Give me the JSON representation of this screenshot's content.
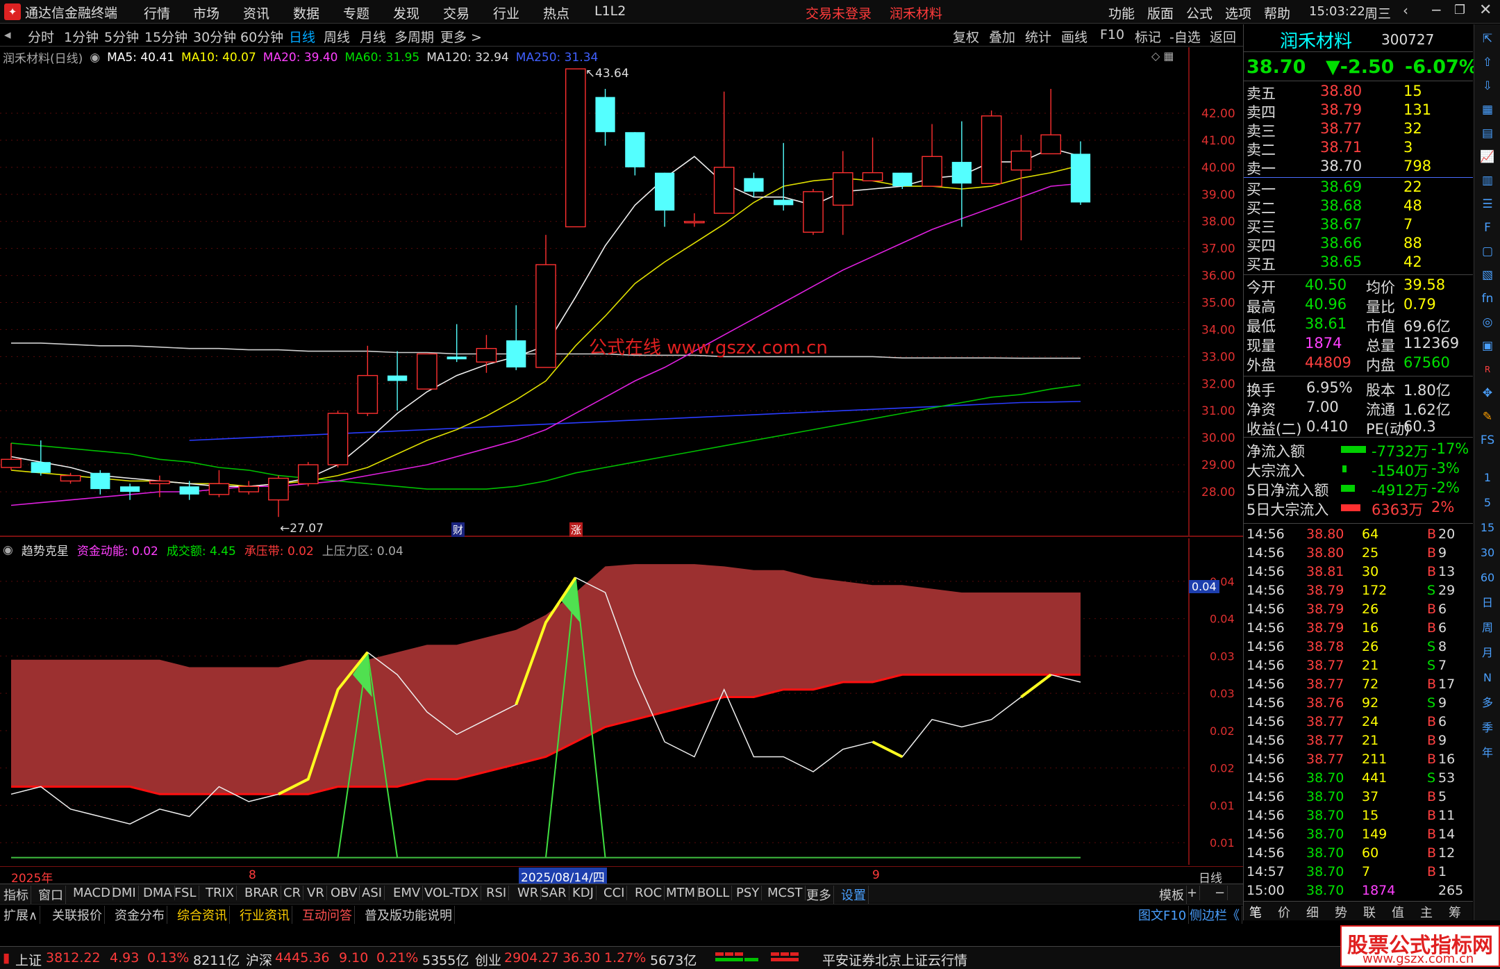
{
  "menubar": {
    "app_title": "通达信金融终端",
    "menu": [
      "行情",
      "市场",
      "资讯",
      "数据",
      "专题",
      "发现",
      "交易",
      "行业",
      "热点",
      "L1L2"
    ],
    "trade_status": "交易未登录",
    "stock_name": "润禾材料",
    "right_menu": [
      "功能",
      "版面",
      "公式",
      "选项",
      "帮助"
    ],
    "time": "15:03:22",
    "weekday": "周三"
  },
  "periods": [
    "分时",
    "1分钟",
    "5分钟",
    "15分钟",
    "30分钟",
    "60分钟",
    "日线",
    "周线",
    "月线",
    "多周期",
    "更多 >"
  ],
  "active_period": "日线",
  "toolbar_right": [
    "复权",
    "叠加",
    "统计",
    "画线",
    "F10",
    "标记",
    "-自选",
    "返回"
  ],
  "main_legend": {
    "name": "润禾材料(日线)",
    "ma5": "MA5: 40.41",
    "ma10": "MA10: 40.07",
    "ma20": "MA20: 39.40",
    "ma60": "MA60: 31.95",
    "ma120": "MA120: 32.94",
    "ma250": "MA250: 31.34"
  },
  "price_axis": [
    "42.00",
    "41.00",
    "40.00",
    "39.00",
    "38.00",
    "37.00",
    "36.00",
    "35.00",
    "34.00",
    "33.00",
    "32.00",
    "31.00",
    "30.00",
    "29.00",
    "28.00"
  ],
  "high_label": "43.64",
  "low_label": "27.07",
  "event_tags": [
    "财",
    "涨"
  ],
  "overlay_watermark": "公式在线  www.gszx.com.cn",
  "chart_data": [
    {
      "type": "candlestick",
      "title": "润禾材料(日线)",
      "candles": [
        {
          "o": 28.9,
          "c": 29.2,
          "h": 29.8,
          "l": 28.8
        },
        {
          "o": 29.1,
          "c": 28.7,
          "h": 29.9,
          "l": 28.6
        },
        {
          "o": 28.4,
          "c": 28.6,
          "h": 28.7,
          "l": 28.3
        },
        {
          "o": 28.7,
          "c": 28.1,
          "h": 28.8,
          "l": 27.9
        },
        {
          "o": 28.2,
          "c": 28.0,
          "h": 28.3,
          "l": 27.7
        },
        {
          "o": 28.3,
          "c": 28.4,
          "h": 28.6,
          "l": 27.8
        },
        {
          "o": 28.2,
          "c": 27.9,
          "h": 28.4,
          "l": 27.7
        },
        {
          "o": 27.9,
          "c": 28.3,
          "h": 28.8,
          "l": 27.8
        },
        {
          "o": 28.0,
          "c": 28.2,
          "h": 28.4,
          "l": 27.9
        },
        {
          "o": 27.7,
          "c": 28.5,
          "h": 28.6,
          "l": 27.07
        },
        {
          "o": 28.3,
          "c": 29.0,
          "h": 29.1,
          "l": 28.2
        },
        {
          "o": 29.0,
          "c": 30.9,
          "h": 31.0,
          "l": 28.9
        },
        {
          "o": 30.9,
          "c": 32.3,
          "h": 33.4,
          "l": 30.8
        },
        {
          "o": 32.3,
          "c": 32.1,
          "h": 33.2,
          "l": 31.0
        },
        {
          "o": 31.8,
          "c": 33.1,
          "h": 33.1,
          "l": 31.8
        },
        {
          "o": 33.0,
          "c": 32.9,
          "h": 34.2,
          "l": 32.8
        },
        {
          "o": 32.8,
          "c": 33.3,
          "h": 33.8,
          "l": 32.4
        },
        {
          "o": 33.6,
          "c": 32.6,
          "h": 34.9,
          "l": 32.5
        },
        {
          "o": 32.6,
          "c": 36.4,
          "h": 37.5,
          "l": 32.6
        },
        {
          "o": 37.8,
          "c": 43.64,
          "h": 43.64,
          "l": 37.8
        },
        {
          "o": 42.6,
          "c": 41.3,
          "h": 42.9,
          "l": 40.8
        },
        {
          "o": 41.3,
          "c": 40.0,
          "h": 41.3,
          "l": 39.7
        },
        {
          "o": 39.8,
          "c": 38.4,
          "h": 39.8,
          "l": 37.8
        },
        {
          "o": 38.0,
          "c": 38.0,
          "h": 38.3,
          "l": 37.8
        },
        {
          "o": 38.3,
          "c": 40.0,
          "h": 42.8,
          "l": 38.3
        },
        {
          "o": 39.6,
          "c": 39.1,
          "h": 39.8,
          "l": 38.9
        },
        {
          "o": 38.8,
          "c": 38.6,
          "h": 40.9,
          "l": 38.4
        },
        {
          "o": 37.6,
          "c": 39.1,
          "h": 39.2,
          "l": 37.5
        },
        {
          "o": 38.6,
          "c": 39.8,
          "h": 40.6,
          "l": 37.5
        },
        {
          "o": 39.5,
          "c": 39.8,
          "h": 41.1,
          "l": 39.5
        },
        {
          "o": 39.8,
          "c": 39.3,
          "h": 39.8,
          "l": 39.2
        },
        {
          "o": 39.3,
          "c": 40.4,
          "h": 41.6,
          "l": 39.3
        },
        {
          "o": 40.2,
          "c": 39.4,
          "h": 41.7,
          "l": 37.8
        },
        {
          "o": 39.4,
          "c": 41.9,
          "h": 42.1,
          "l": 39.4
        },
        {
          "o": 39.9,
          "c": 40.6,
          "h": 41.2,
          "l": 37.3
        },
        {
          "o": 40.5,
          "c": 41.2,
          "h": 42.9,
          "l": 40.5
        },
        {
          "o": 40.5,
          "c": 38.7,
          "h": 40.96,
          "l": 38.61
        }
      ],
      "ma5": [
        29.3,
        29.1,
        28.9,
        28.6,
        28.5,
        28.4,
        28.3,
        28.2,
        28.2,
        28.3,
        28.5,
        29.0,
        29.9,
        30.9,
        31.7,
        32.3,
        32.7,
        33.0,
        33.4,
        35.2,
        37.1,
        38.6,
        39.6,
        40.4,
        39.4,
        38.9,
        38.9,
        38.6,
        39.1,
        39.2,
        39.3,
        39.6,
        39.7,
        40.2,
        40.2,
        40.7,
        40.41
      ],
      "ma10": [
        28.8,
        28.7,
        28.6,
        28.5,
        28.4,
        28.4,
        28.3,
        28.3,
        28.2,
        28.3,
        28.4,
        28.6,
        28.9,
        29.4,
        29.9,
        30.3,
        30.8,
        31.4,
        32.1,
        33.4,
        34.5,
        35.7,
        36.5,
        37.2,
        37.9,
        38.7,
        39.3,
        39.5,
        39.6,
        39.5,
        39.3,
        39.3,
        39.2,
        39.3,
        39.6,
        39.8,
        40.07
      ],
      "ma20": [
        27.5,
        27.6,
        27.7,
        27.8,
        27.9,
        28.0,
        28.0,
        28.1,
        28.2,
        28.2,
        28.3,
        28.4,
        28.6,
        28.8,
        29.0,
        29.3,
        29.6,
        29.9,
        30.3,
        30.9,
        31.5,
        32.1,
        32.6,
        33.2,
        33.8,
        34.4,
        35.0,
        35.6,
        36.2,
        36.7,
        37.2,
        37.7,
        38.1,
        38.5,
        38.9,
        39.3,
        39.4
      ],
      "ma60": [
        29.8,
        29.7,
        29.6,
        29.5,
        29.4,
        29.2,
        29.1,
        28.9,
        28.8,
        28.6,
        28.5,
        28.4,
        28.3,
        28.2,
        28.1,
        28.1,
        28.1,
        28.2,
        28.4,
        28.7,
        28.9,
        29.1,
        29.3,
        29.5,
        29.7,
        29.9,
        30.1,
        30.3,
        30.5,
        30.7,
        30.9,
        31.1,
        31.3,
        31.5,
        31.6,
        31.8,
        31.95
      ],
      "ma120": [
        33.5,
        33.5,
        33.45,
        33.4,
        33.4,
        33.35,
        33.3,
        33.3,
        33.25,
        33.25,
        33.2,
        33.2,
        33.2,
        33.15,
        33.15,
        33.1,
        33.1,
        33.1,
        33.1,
        33.1,
        33.1,
        33.05,
        33.05,
        33.05,
        33.0,
        33.0,
        33.0,
        33.0,
        33.0,
        33.0,
        32.95,
        32.95,
        32.95,
        32.95,
        32.94,
        32.94,
        32.94
      ],
      "ma250": [
        null,
        null,
        null,
        null,
        null,
        null,
        29.9,
        29.95,
        30.0,
        30.05,
        30.1,
        30.15,
        30.2,
        30.25,
        30.3,
        30.35,
        30.4,
        30.45,
        30.5,
        30.55,
        30.6,
        30.65,
        30.7,
        30.75,
        30.8,
        30.85,
        30.9,
        30.95,
        31.0,
        31.05,
        31.1,
        31.15,
        31.2,
        31.25,
        31.3,
        31.32,
        31.34
      ]
    },
    {
      "type": "area",
      "title": "趋势克星",
      "ylim": [
        0.005,
        0.045
      ],
      "band_upper": [
        0.032,
        0.032,
        0.032,
        0.032,
        0.032,
        0.032,
        0.031,
        0.031,
        0.031,
        0.031,
        0.032,
        0.032,
        0.032,
        0.033,
        0.034,
        0.034,
        0.035,
        0.036,
        0.038,
        0.041,
        0.0445,
        0.0448,
        0.0448,
        0.0448,
        0.0445,
        0.044,
        0.044,
        0.043,
        0.0425,
        0.042,
        0.042,
        0.0415,
        0.041,
        0.041,
        0.041,
        0.041,
        0.041
      ],
      "band_lower": [
        0.015,
        0.015,
        0.015,
        0.015,
        0.015,
        0.014,
        0.014,
        0.014,
        0.014,
        0.014,
        0.014,
        0.015,
        0.015,
        0.015,
        0.016,
        0.016,
        0.017,
        0.018,
        0.019,
        0.021,
        0.023,
        0.024,
        0.025,
        0.026,
        0.027,
        0.027,
        0.028,
        0.028,
        0.029,
        0.029,
        0.03,
        0.03,
        0.03,
        0.03,
        0.03,
        0.03,
        0.03
      ],
      "fund_momentum": [
        0.014,
        0.015,
        0.012,
        0.011,
        0.01,
        0.012,
        0.011,
        0.015,
        0.013,
        0.014,
        0.016,
        0.028,
        0.033,
        0.03,
        0.025,
        0.022,
        0.024,
        0.026,
        0.037,
        0.043,
        0.041,
        0.03,
        0.021,
        0.019,
        0.028,
        0.019,
        0.019,
        0.017,
        0.02,
        0.021,
        0.019,
        0.024,
        0.023,
        0.024,
        0.027,
        0.03,
        0.029
      ],
      "spike": [
        0,
        0,
        0,
        0,
        0,
        0,
        0,
        0,
        0,
        0,
        0,
        0,
        0.033,
        0,
        0,
        0,
        0,
        0,
        0,
        0.043,
        0,
        0,
        0,
        0,
        0,
        0,
        0,
        0,
        0,
        0,
        0,
        0,
        0,
        0,
        0,
        0,
        0
      ]
    }
  ],
  "sub_legend": {
    "name": "趋势克星",
    "fund": "资金动能: 0.02",
    "volume": "成交额: 4.45",
    "support": "承压带: 0.02",
    "pressure": "上压力区: 0.04"
  },
  "sub_axis": [
    "0.04",
    "0.04",
    "0.03",
    "0.03",
    "0.02",
    "0.02",
    "0.01",
    "0.01"
  ],
  "sub_current": "0.04",
  "date_axis": {
    "year": "2025年",
    "m8": "8",
    "cursor_date": "2025/08/14/四",
    "m9": "9",
    "period": "日线"
  },
  "indicator_tabs": [
    "指标",
    "窗口",
    "MACD",
    "DMI",
    "DMA",
    "FSL",
    "TRIX",
    "BRAR",
    "CR",
    "VR",
    "OBV",
    "ASI",
    "EMV",
    "VOL-TDX",
    "RSI",
    "WR",
    "SAR",
    "KDJ",
    "CCI",
    "ROC",
    "MTM",
    "BOLL",
    "PSY",
    "MCST",
    "更多",
    "设置",
    "模板",
    "+",
    "−"
  ],
  "bottom_tabs": [
    "扩展∧",
    "关联报价",
    "资金分布",
    "综合资讯",
    "行业资讯",
    "互动问答",
    "普及版功能说明",
    "图文F10",
    "侧边栏《"
  ],
  "quote": {
    "name": "润禾材料",
    "code": "300727",
    "price": "38.70",
    "change": "▼-2.50",
    "pct": "-6.07%",
    "asks": [
      [
        "卖五",
        "38.80",
        "15"
      ],
      [
        "卖四",
        "38.79",
        "131"
      ],
      [
        "卖三",
        "38.77",
        "32"
      ],
      [
        "卖二",
        "38.71",
        "3"
      ],
      [
        "卖一",
        "38.70",
        "798"
      ]
    ],
    "bids": [
      [
        "买一",
        "38.69",
        "22"
      ],
      [
        "买二",
        "38.68",
        "48"
      ],
      [
        "买三",
        "38.67",
        "7"
      ],
      [
        "买四",
        "38.66",
        "88"
      ],
      [
        "买五",
        "38.65",
        "42"
      ]
    ],
    "stats": [
      [
        "今开",
        "40.50",
        "均价",
        "39.58"
      ],
      [
        "最高",
        "40.96",
        "量比",
        "0.79"
      ],
      [
        "最低",
        "38.61",
        "市值",
        "69.6亿"
      ],
      [
        "现量",
        "1874",
        "总量",
        "112369"
      ],
      [
        "外盘",
        "44809",
        "内盘",
        "67560"
      ]
    ],
    "fund": [
      [
        "换手",
        "6.95%",
        "股本",
        "1.80亿"
      ],
      [
        "净资",
        "7.00",
        "流通",
        "1.62亿"
      ],
      [
        "收益(二)",
        "0.410",
        "PE(动)",
        "60.3"
      ]
    ],
    "flows": [
      [
        "净流入额",
        "-7732万",
        "-17%"
      ],
      [
        "大宗流入",
        "-1540万",
        "-3%"
      ],
      [
        "5日净流入额",
        "-4912万",
        "-2%"
      ],
      [
        "5日大宗流入",
        "6363万",
        "2%"
      ]
    ],
    "ticks": [
      [
        "14:56",
        "38.80",
        "64",
        "B",
        "20"
      ],
      [
        "14:56",
        "38.80",
        "25",
        "B",
        "9"
      ],
      [
        "14:56",
        "38.81",
        "30",
        "B",
        "13"
      ],
      [
        "14:56",
        "38.79",
        "172",
        "S",
        "29"
      ],
      [
        "14:56",
        "38.79",
        "26",
        "B",
        "6"
      ],
      [
        "14:56",
        "38.79",
        "16",
        "B",
        "6"
      ],
      [
        "14:56",
        "38.78",
        "26",
        "S",
        "8"
      ],
      [
        "14:56",
        "38.77",
        "21",
        "S",
        "7"
      ],
      [
        "14:56",
        "38.77",
        "72",
        "B",
        "17"
      ],
      [
        "14:56",
        "38.76",
        "92",
        "S",
        "9"
      ],
      [
        "14:56",
        "38.77",
        "24",
        "B",
        "6"
      ],
      [
        "14:56",
        "38.77",
        "21",
        "B",
        "9"
      ],
      [
        "14:56",
        "38.77",
        "211",
        "B",
        "16"
      ],
      [
        "14:56",
        "38.70",
        "441",
        "S",
        "53"
      ],
      [
        "14:56",
        "38.70",
        "37",
        "B",
        "5"
      ],
      [
        "14:56",
        "38.70",
        "15",
        "B",
        "11"
      ],
      [
        "14:56",
        "38.70",
        "149",
        "B",
        "14"
      ],
      [
        "14:56",
        "38.70",
        "60",
        "B",
        "12"
      ],
      [
        "14:57",
        "38.70",
        "7",
        "B",
        "1"
      ],
      [
        "15:00",
        "38.70",
        "1874",
        "",
        "265"
      ]
    ],
    "tabs": [
      "笔",
      "价",
      "细",
      "势",
      "联",
      "值",
      "主",
      "筹"
    ]
  },
  "sidebar_icons": [
    "pin-icon",
    "up-arrow-icon",
    "down-arrow-icon",
    "grid-icon",
    "table-icon",
    "chart-icon",
    "candle-icon",
    "list-icon",
    "f10-icon",
    "doc-icon",
    "report-icon",
    "fn-icon",
    "circle-icon",
    "ticker-icon",
    "rsi-icon",
    "move-icon",
    "pen-icon",
    "fs-icon"
  ],
  "sidebar_labels": [
    "1",
    "5",
    "15",
    "30",
    "60",
    "日",
    "周",
    "月",
    "N",
    "多",
    "季",
    "年"
  ],
  "status": {
    "sh_label": "上证",
    "sh_val": "3812.22",
    "sh_chg": "4.93",
    "sh_pct": "0.13%",
    "sh_amt": "8211亿",
    "hs_label": "沪深",
    "hs_val": "4445.36",
    "hs_chg": "9.10",
    "hs_pct": "0.21%",
    "hs_amt": "5355亿",
    "cy_label": "创业",
    "cy_val": "2904.27",
    "cy_chg": "36.30",
    "cy_pct": "1.27%",
    "cy_amt": "5673亿",
    "server": "平安证券北京上证云行情"
  },
  "brand": {
    "title": "股票公式指标网",
    "url": "www.gszx.com.cn"
  }
}
